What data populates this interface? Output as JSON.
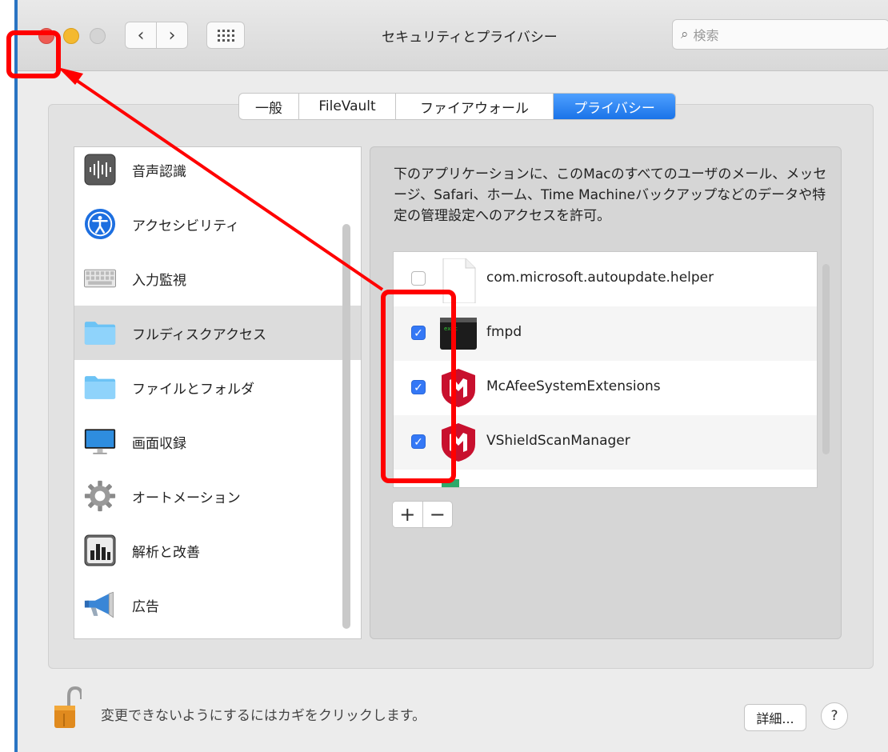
{
  "window": {
    "title": "セキュリティとプライバシー",
    "search_placeholder": "検索"
  },
  "nav": {
    "back": "‹",
    "forward": "›"
  },
  "tabs": [
    {
      "label": "一般",
      "active": false
    },
    {
      "label": "FileVault",
      "active": false
    },
    {
      "label": "ファイアウォール",
      "active": false
    },
    {
      "label": "プライバシー",
      "active": true
    }
  ],
  "sidebar": {
    "selected": "フルディスクアクセス",
    "items": [
      {
        "label": "音声認識",
        "icon": "waveform-icon"
      },
      {
        "label": "アクセシビリティ",
        "icon": "accessibility-icon"
      },
      {
        "label": "入力監視",
        "icon": "keyboard-icon"
      },
      {
        "label": "フルディスクアクセス",
        "icon": "folder-icon"
      },
      {
        "label": "ファイルとフォルダ",
        "icon": "folder-icon"
      },
      {
        "label": "画面収録",
        "icon": "display-icon"
      },
      {
        "label": "オートメーション",
        "icon": "gear-icon"
      },
      {
        "label": "解析と改善",
        "icon": "chart-icon"
      },
      {
        "label": "広告",
        "icon": "megaphone-icon"
      }
    ]
  },
  "description": "下のアプリケーションに、このMacのすべてのユーザのメール、メッセージ、Safari、ホーム、Time Machineバックアップなどのデータや特定の管理設定へのアクセスを許可。",
  "apps": [
    {
      "name": "com.microsoft.autoupdate.helper",
      "checked": false,
      "icon": "document-icon"
    },
    {
      "name": "fmpd",
      "checked": true,
      "icon": "terminal-icon"
    },
    {
      "name": "McAfeeSystemExtensions",
      "checked": true,
      "icon": "mcafee-shield-icon"
    },
    {
      "name": "VShieldScanManager",
      "checked": true,
      "icon": "mcafee-shield-icon"
    }
  ],
  "list_controls": {
    "add": "+",
    "remove": "−"
  },
  "footer": {
    "lock_text": "変更できないようにするにはカギをクリックします。",
    "detail_button": "詳細...",
    "help_button": "?"
  },
  "colors": {
    "accent": "#1a73e8",
    "annotation": "#ff0000",
    "mcafee_red": "#c8102e"
  }
}
